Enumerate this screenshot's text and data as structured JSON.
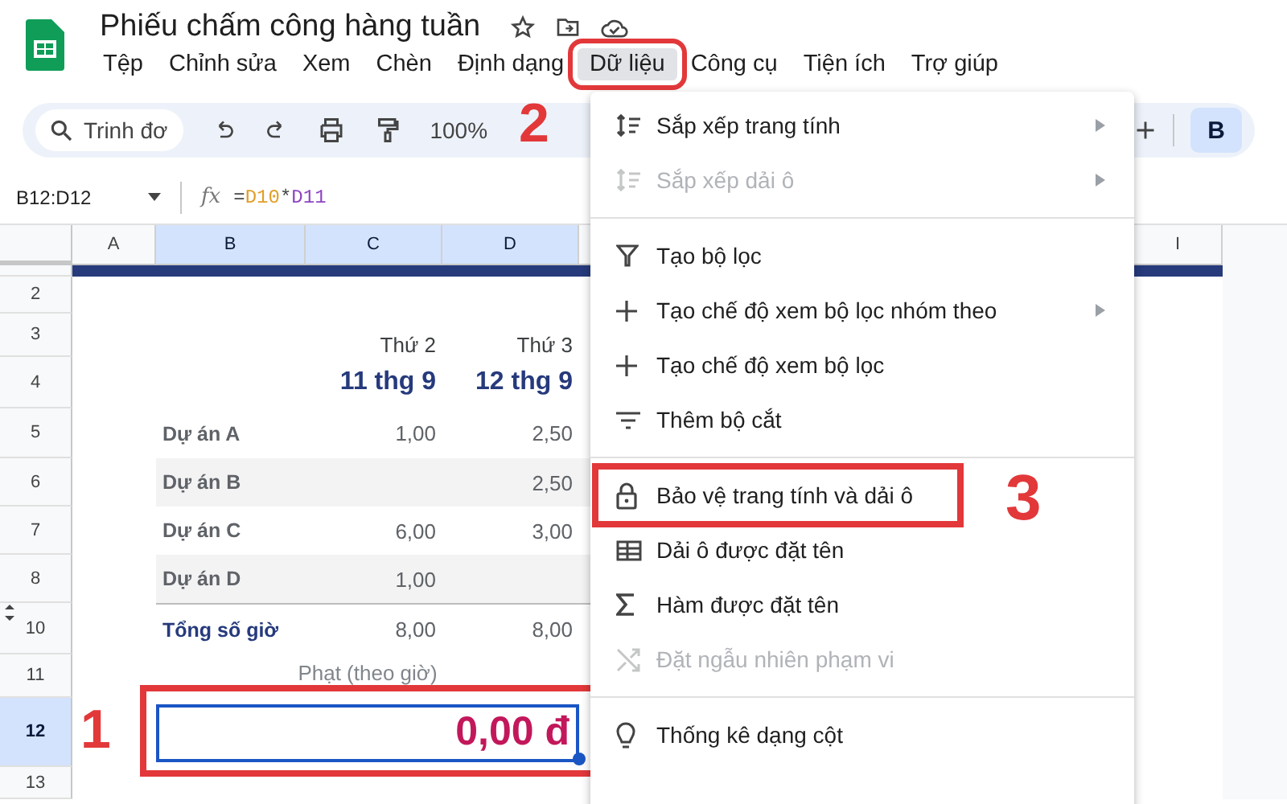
{
  "app": {
    "title": "Phiếu chấm công hàng tuần"
  },
  "menubar": [
    {
      "label": "Tệp",
      "selected": false
    },
    {
      "label": "Chỉnh sửa",
      "selected": false
    },
    {
      "label": "Xem",
      "selected": false
    },
    {
      "label": "Chèn",
      "selected": false
    },
    {
      "label": "Định dạng",
      "selected": false
    },
    {
      "label": "Dữ liệu",
      "selected": true,
      "callout": "2"
    },
    {
      "label": "Công cụ",
      "selected": false
    },
    {
      "label": "Tiện ích",
      "selected": false
    },
    {
      "label": "Trợ giúp",
      "selected": false
    }
  ],
  "toolbar": {
    "search_placeholder": "Trinh đơ",
    "zoom": "100%",
    "bold_button": {
      "label": "B",
      "selected": true
    }
  },
  "formula_bar": {
    "cell_ref": "B12:D12",
    "function_label": "fx",
    "tokens": [
      {
        "text": "=",
        "color": "#444746"
      },
      {
        "text": "D10",
        "color": "#e19e27"
      },
      {
        "text": "*",
        "color": "#444746"
      },
      {
        "text": "D11",
        "color": "#8e44c2"
      }
    ]
  },
  "columns": [
    {
      "label": "A",
      "selected": false
    },
    {
      "label": "B",
      "selected": true
    },
    {
      "label": "C",
      "selected": true
    },
    {
      "label": "D",
      "selected": true
    },
    {
      "label": "I",
      "selected": false
    }
  ],
  "rows": [
    {
      "number": "2",
      "selected": false,
      "kind": "blank"
    },
    {
      "number": "3",
      "selected": false,
      "kind": "day",
      "c": "Thứ 2",
      "d": "Thứ 3"
    },
    {
      "number": "4",
      "selected": false,
      "kind": "date",
      "c": "11 thg 9",
      "d": "12 thg 9"
    },
    {
      "number": "5",
      "selected": false,
      "kind": "project",
      "striped": false,
      "b": "Dự án A",
      "c": "1,00",
      "d": "2,50"
    },
    {
      "number": "6",
      "selected": false,
      "kind": "project",
      "striped": true,
      "b": "Dự án B",
      "d": "2,50"
    },
    {
      "number": "7",
      "selected": false,
      "kind": "project",
      "striped": false,
      "b": "Dự án C",
      "c": "6,00",
      "d": "3,00"
    },
    {
      "number": "8",
      "selected": false,
      "kind": "project",
      "striped": true,
      "b": "Dự án D",
      "c": "1,00"
    },
    {
      "number": "10",
      "selected": false,
      "kind": "total",
      "b": "Tổng số giờ",
      "c": "8,00",
      "d": "8,00"
    },
    {
      "number": "11",
      "selected": false,
      "kind": "label",
      "caption": "Phạt (theo giờ)"
    },
    {
      "number": "12",
      "selected": true,
      "kind": "result",
      "value": "0,00 đ",
      "callout": "1"
    },
    {
      "number": "13",
      "selected": false,
      "kind": "blank"
    }
  ],
  "dropdown": [
    {
      "kind": "item",
      "label": "Sắp xếp trang tính",
      "disabled": false,
      "submenu": true
    },
    {
      "kind": "item",
      "label": "Sắp xếp dải ô",
      "disabled": true,
      "submenu": true
    },
    {
      "kind": "divider"
    },
    {
      "kind": "item",
      "label": "Tạo bộ lọc",
      "disabled": false,
      "submenu": false
    },
    {
      "kind": "item",
      "label": "Tạo chế độ xem bộ lọc nhóm theo",
      "disabled": false,
      "submenu": true
    },
    {
      "kind": "item",
      "label": "Tạo chế độ xem bộ lọc",
      "disabled": false,
      "submenu": false
    },
    {
      "kind": "item",
      "label": "Thêm bộ cắt",
      "disabled": false,
      "submenu": false
    },
    {
      "kind": "divider"
    },
    {
      "kind": "item",
      "label": "Bảo vệ trang tính và dải ô",
      "disabled": false,
      "submenu": false,
      "callout": "3"
    },
    {
      "kind": "item",
      "label": "Dải ô được đặt tên",
      "disabled": false,
      "submenu": false
    },
    {
      "kind": "item",
      "label": "Hàm được đặt tên",
      "disabled": false,
      "submenu": false
    },
    {
      "kind": "item",
      "label": "Đặt ngẫu nhiên phạm vi",
      "disabled": true,
      "submenu": false
    },
    {
      "kind": "divider"
    },
    {
      "kind": "item",
      "label": "Thống kê dạng cột",
      "disabled": false,
      "submenu": false
    }
  ]
}
